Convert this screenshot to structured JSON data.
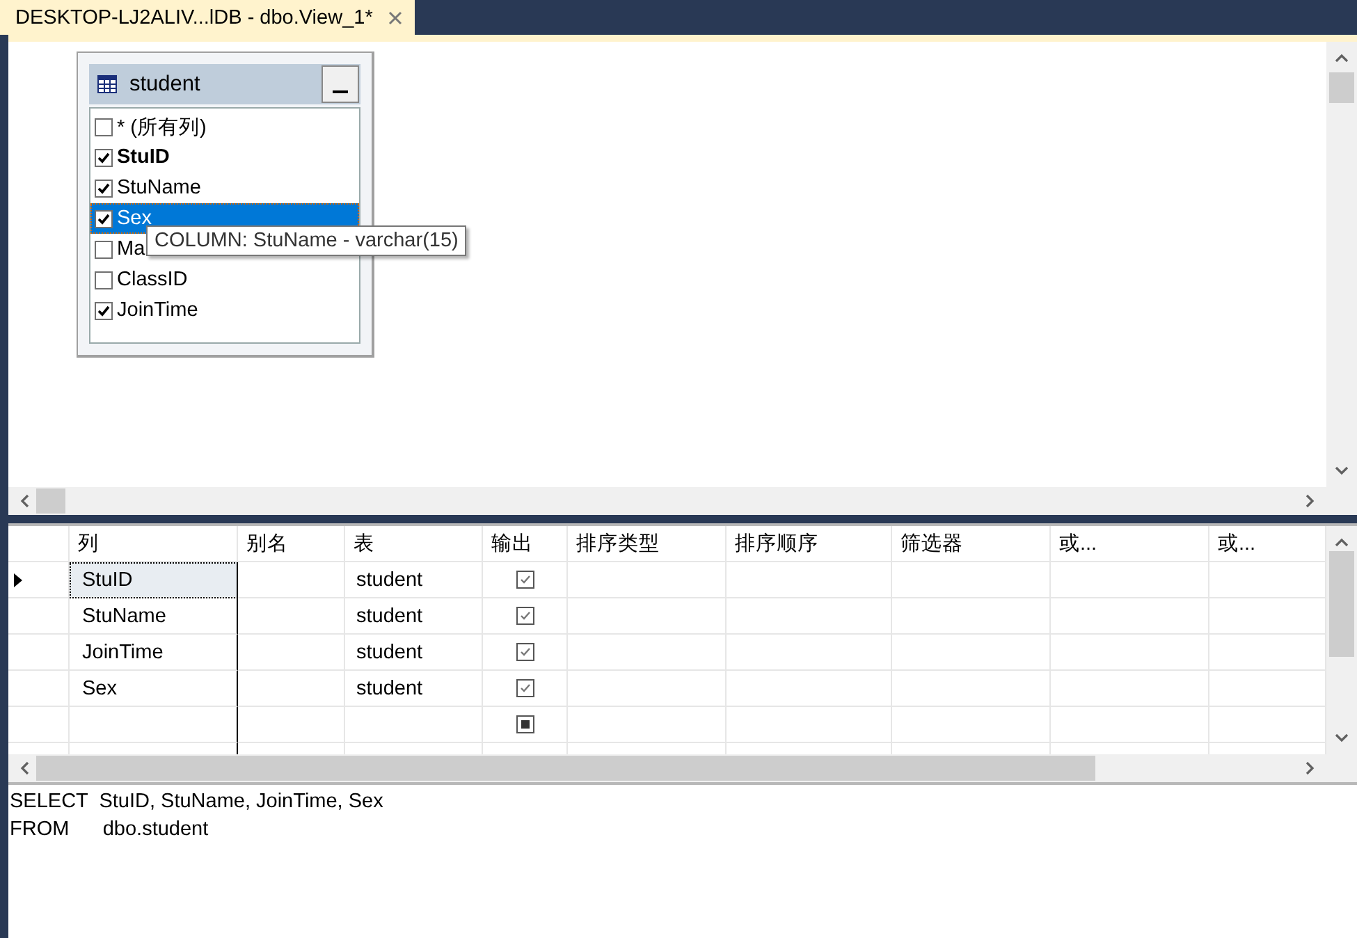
{
  "tab": {
    "title": "DESKTOP-LJ2ALIV...lDB - dbo.View_1*",
    "selected": true
  },
  "diagram": {
    "table": {
      "name": "student",
      "columns": [
        {
          "name": "* (所有列)",
          "checked": false,
          "key": false,
          "selected": false
        },
        {
          "name": "StuID",
          "checked": true,
          "key": true,
          "selected": false
        },
        {
          "name": "StuName",
          "checked": true,
          "key": false,
          "selected": false
        },
        {
          "name": "Sex",
          "checked": true,
          "key": false,
          "selected": true
        },
        {
          "name": "Ma",
          "checked": false,
          "key": false,
          "selected": false
        },
        {
          "name": "ClassID",
          "checked": false,
          "key": false,
          "selected": false
        },
        {
          "name": "JoinTime",
          "checked": true,
          "key": false,
          "selected": false
        }
      ]
    },
    "tooltip": "COLUMN: StuName - varchar(15)"
  },
  "grid": {
    "columns": [
      "列",
      "别名",
      "表",
      "输出",
      "排序类型",
      "排序顺序",
      "筛选器",
      "或...",
      "或..."
    ],
    "rows": [
      {
        "column": "StuID",
        "table": "student",
        "output": true,
        "output_indeterminate": false,
        "current": true
      },
      {
        "column": "StuName",
        "table": "student",
        "output": true,
        "output_indeterminate": false,
        "current": false
      },
      {
        "column": "JoinTime",
        "table": "student",
        "output": true,
        "output_indeterminate": false,
        "current": false
      },
      {
        "column": "Sex",
        "table": "student",
        "output": true,
        "output_indeterminate": false,
        "current": false
      },
      {
        "output_indeterminate": true,
        "current": false
      },
      {
        "current": false
      }
    ]
  },
  "sql": [
    "SELECT  StuID, StuName, JoinTime, Sex",
    "FROM      dbo.student"
  ]
}
